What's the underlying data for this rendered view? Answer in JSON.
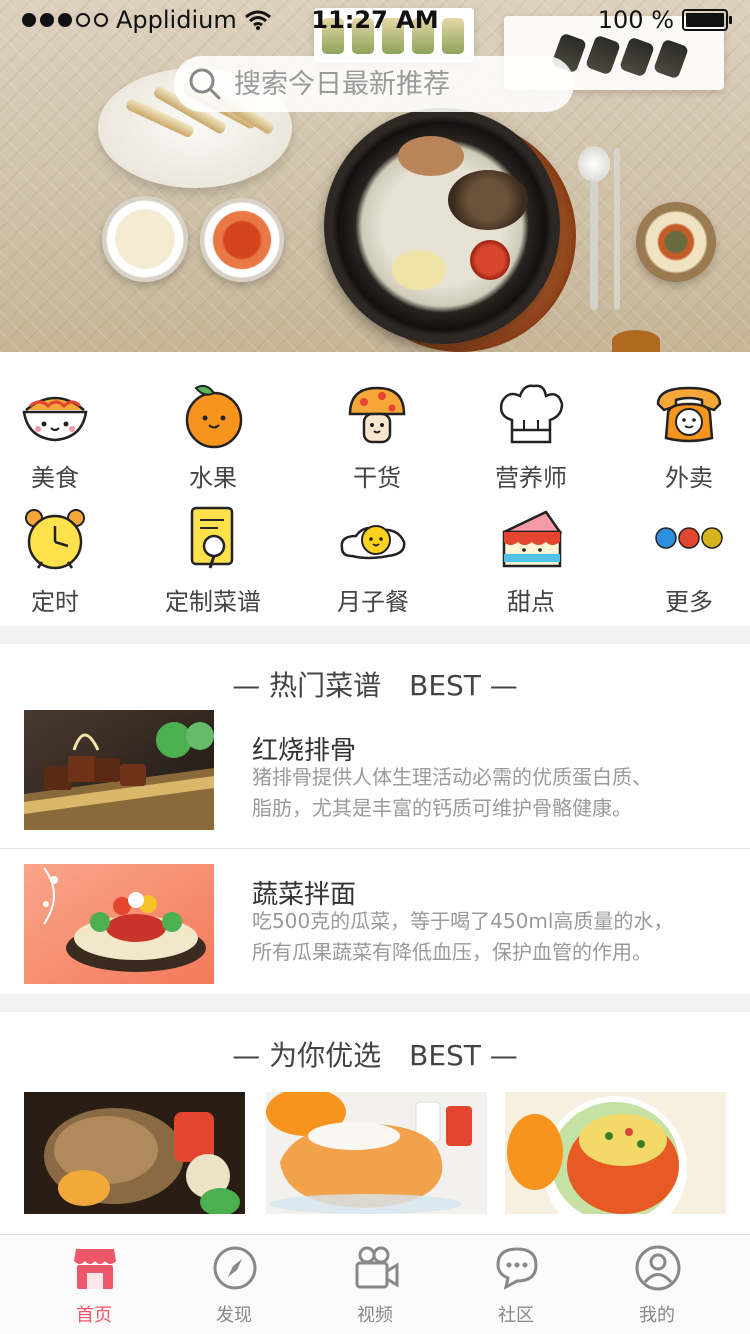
{
  "status_bar": {
    "carrier": "Applidium",
    "time": "11:27 AM",
    "battery": "100 %"
  },
  "search": {
    "placeholder": "搜索今日最新推荐"
  },
  "categories": [
    {
      "label": "美食",
      "icon": "noodle-bowl-icon"
    },
    {
      "label": "水果",
      "icon": "orange-icon"
    },
    {
      "label": "干货",
      "icon": "mushroom-icon"
    },
    {
      "label": "营养师",
      "icon": "chef-hat-icon"
    },
    {
      "label": "外卖",
      "icon": "telephone-icon"
    },
    {
      "label": "定时",
      "icon": "alarm-clock-icon"
    },
    {
      "label": "定制菜谱",
      "icon": "recipe-book-icon"
    },
    {
      "label": "月子餐",
      "icon": "fried-egg-icon"
    },
    {
      "label": "甜点",
      "icon": "cake-icon"
    },
    {
      "label": "更多",
      "icon": "more-dots-icon"
    }
  ],
  "hot_recipes": {
    "title": "— 热门菜谱　BEST —",
    "items": [
      {
        "name": "红烧排骨",
        "desc_line1": "猪排骨提供人体生理活动必需的优质蛋白质、",
        "desc_line2": "脂肪，尤其是丰富的钙质可维护骨骼健康。"
      },
      {
        "name": "蔬菜拌面",
        "desc_line1": "吃500克的瓜菜，等于喝了450ml高质量的水，",
        "desc_line2": "所有瓜果蔬菜有降低血压，保护血管的作用。"
      }
    ]
  },
  "picks": {
    "title": "— 为你优选　BEST —",
    "items": [
      {
        "caption": "",
        "image": "roast-chicken-photo"
      },
      {
        "caption": "",
        "image": "papaya-dessert-photo"
      },
      {
        "caption": "",
        "image": "stuffed-pumpkin-photo"
      }
    ]
  },
  "tabbar": {
    "items": [
      {
        "label": "首页",
        "icon": "shop-icon",
        "active": true
      },
      {
        "label": "发现",
        "icon": "compass-icon",
        "active": false
      },
      {
        "label": "视频",
        "icon": "video-camera-icon",
        "active": false
      },
      {
        "label": "社区",
        "icon": "chat-bubble-icon",
        "active": false
      },
      {
        "label": "我的",
        "icon": "user-icon",
        "active": false
      }
    ]
  },
  "colors": {
    "accent": "#f0566a",
    "section_gap": "#f2f2f2",
    "muted_text": "#9a9a9a"
  }
}
